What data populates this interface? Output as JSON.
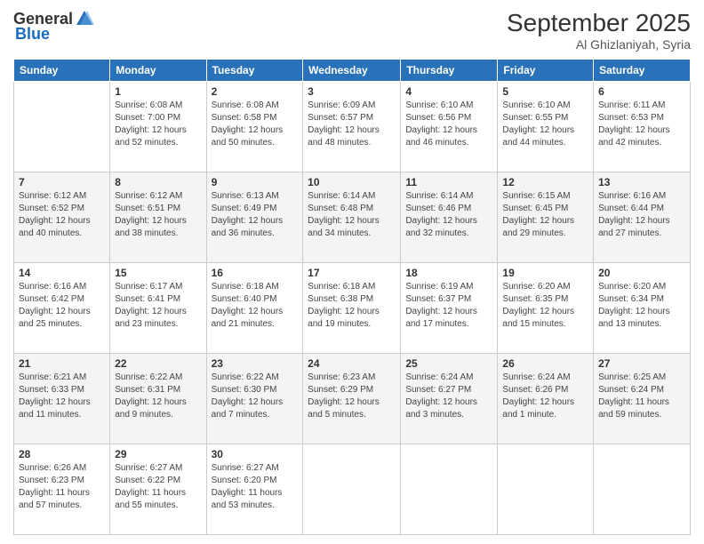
{
  "header": {
    "logo_general": "General",
    "logo_blue": "Blue",
    "month_year": "September 2025",
    "location": "Al Ghizlaniyah, Syria"
  },
  "days_of_week": [
    "Sunday",
    "Monday",
    "Tuesday",
    "Wednesday",
    "Thursday",
    "Friday",
    "Saturday"
  ],
  "weeks": [
    [
      {
        "day": "",
        "empty": true
      },
      {
        "day": "1",
        "sunrise": "6:08 AM",
        "sunset": "7:00 PM",
        "daylight": "12 hours and 52 minutes."
      },
      {
        "day": "2",
        "sunrise": "6:08 AM",
        "sunset": "6:58 PM",
        "daylight": "12 hours and 50 minutes."
      },
      {
        "day": "3",
        "sunrise": "6:09 AM",
        "sunset": "6:57 PM",
        "daylight": "12 hours and 48 minutes."
      },
      {
        "day": "4",
        "sunrise": "6:10 AM",
        "sunset": "6:56 PM",
        "daylight": "12 hours and 46 minutes."
      },
      {
        "day": "5",
        "sunrise": "6:10 AM",
        "sunset": "6:55 PM",
        "daylight": "12 hours and 44 minutes."
      },
      {
        "day": "6",
        "sunrise": "6:11 AM",
        "sunset": "6:53 PM",
        "daylight": "12 hours and 42 minutes."
      }
    ],
    [
      {
        "day": "7",
        "sunrise": "6:12 AM",
        "sunset": "6:52 PM",
        "daylight": "12 hours and 40 minutes."
      },
      {
        "day": "8",
        "sunrise": "6:12 AM",
        "sunset": "6:51 PM",
        "daylight": "12 hours and 38 minutes."
      },
      {
        "day": "9",
        "sunrise": "6:13 AM",
        "sunset": "6:49 PM",
        "daylight": "12 hours and 36 minutes."
      },
      {
        "day": "10",
        "sunrise": "6:14 AM",
        "sunset": "6:48 PM",
        "daylight": "12 hours and 34 minutes."
      },
      {
        "day": "11",
        "sunrise": "6:14 AM",
        "sunset": "6:46 PM",
        "daylight": "12 hours and 32 minutes."
      },
      {
        "day": "12",
        "sunrise": "6:15 AM",
        "sunset": "6:45 PM",
        "daylight": "12 hours and 29 minutes."
      },
      {
        "day": "13",
        "sunrise": "6:16 AM",
        "sunset": "6:44 PM",
        "daylight": "12 hours and 27 minutes."
      }
    ],
    [
      {
        "day": "14",
        "sunrise": "6:16 AM",
        "sunset": "6:42 PM",
        "daylight": "12 hours and 25 minutes."
      },
      {
        "day": "15",
        "sunrise": "6:17 AM",
        "sunset": "6:41 PM",
        "daylight": "12 hours and 23 minutes."
      },
      {
        "day": "16",
        "sunrise": "6:18 AM",
        "sunset": "6:40 PM",
        "daylight": "12 hours and 21 minutes."
      },
      {
        "day": "17",
        "sunrise": "6:18 AM",
        "sunset": "6:38 PM",
        "daylight": "12 hours and 19 minutes."
      },
      {
        "day": "18",
        "sunrise": "6:19 AM",
        "sunset": "6:37 PM",
        "daylight": "12 hours and 17 minutes."
      },
      {
        "day": "19",
        "sunrise": "6:20 AM",
        "sunset": "6:35 PM",
        "daylight": "12 hours and 15 minutes."
      },
      {
        "day": "20",
        "sunrise": "6:20 AM",
        "sunset": "6:34 PM",
        "daylight": "12 hours and 13 minutes."
      }
    ],
    [
      {
        "day": "21",
        "sunrise": "6:21 AM",
        "sunset": "6:33 PM",
        "daylight": "12 hours and 11 minutes."
      },
      {
        "day": "22",
        "sunrise": "6:22 AM",
        "sunset": "6:31 PM",
        "daylight": "12 hours and 9 minutes."
      },
      {
        "day": "23",
        "sunrise": "6:22 AM",
        "sunset": "6:30 PM",
        "daylight": "12 hours and 7 minutes."
      },
      {
        "day": "24",
        "sunrise": "6:23 AM",
        "sunset": "6:29 PM",
        "daylight": "12 hours and 5 minutes."
      },
      {
        "day": "25",
        "sunrise": "6:24 AM",
        "sunset": "6:27 PM",
        "daylight": "12 hours and 3 minutes."
      },
      {
        "day": "26",
        "sunrise": "6:24 AM",
        "sunset": "6:26 PM",
        "daylight": "12 hours and 1 minute."
      },
      {
        "day": "27",
        "sunrise": "6:25 AM",
        "sunset": "6:24 PM",
        "daylight": "11 hours and 59 minutes."
      }
    ],
    [
      {
        "day": "28",
        "sunrise": "6:26 AM",
        "sunset": "6:23 PM",
        "daylight": "11 hours and 57 minutes."
      },
      {
        "day": "29",
        "sunrise": "6:27 AM",
        "sunset": "6:22 PM",
        "daylight": "11 hours and 55 minutes."
      },
      {
        "day": "30",
        "sunrise": "6:27 AM",
        "sunset": "6:20 PM",
        "daylight": "11 hours and 53 minutes."
      },
      {
        "day": "",
        "empty": true
      },
      {
        "day": "",
        "empty": true
      },
      {
        "day": "",
        "empty": true
      },
      {
        "day": "",
        "empty": true
      }
    ]
  ]
}
